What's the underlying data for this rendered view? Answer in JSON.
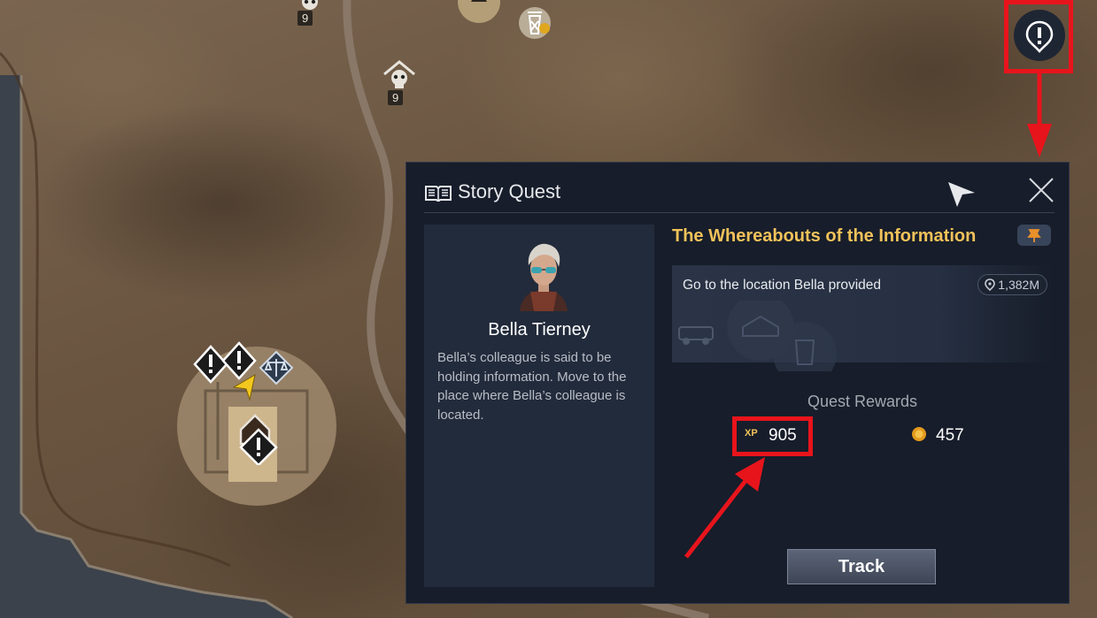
{
  "map": {
    "marker_levels": [
      "9",
      "9"
    ]
  },
  "quest_panel": {
    "header": {
      "title": "Story Quest",
      "icons": [
        "book-icon",
        "navigation-arrow-icon",
        "close-icon"
      ]
    },
    "npc": {
      "name": "Bella Tierney",
      "description": "Bella’s colleague is said to be holding information. Move to the place where Bella’s colleague is located."
    },
    "quest": {
      "name": "The Whereabouts of the Information",
      "objective": "Go to the location Bella provided",
      "distance": "1,382M"
    },
    "rewards": {
      "title": "Quest Rewards",
      "xp_label": "XP",
      "xp": "905",
      "gold": "457"
    },
    "track_label": "Track"
  },
  "colors": {
    "panel_bg": "#171d2a",
    "quest_title": "#f2c25a",
    "annotation_red": "#e8141c"
  }
}
